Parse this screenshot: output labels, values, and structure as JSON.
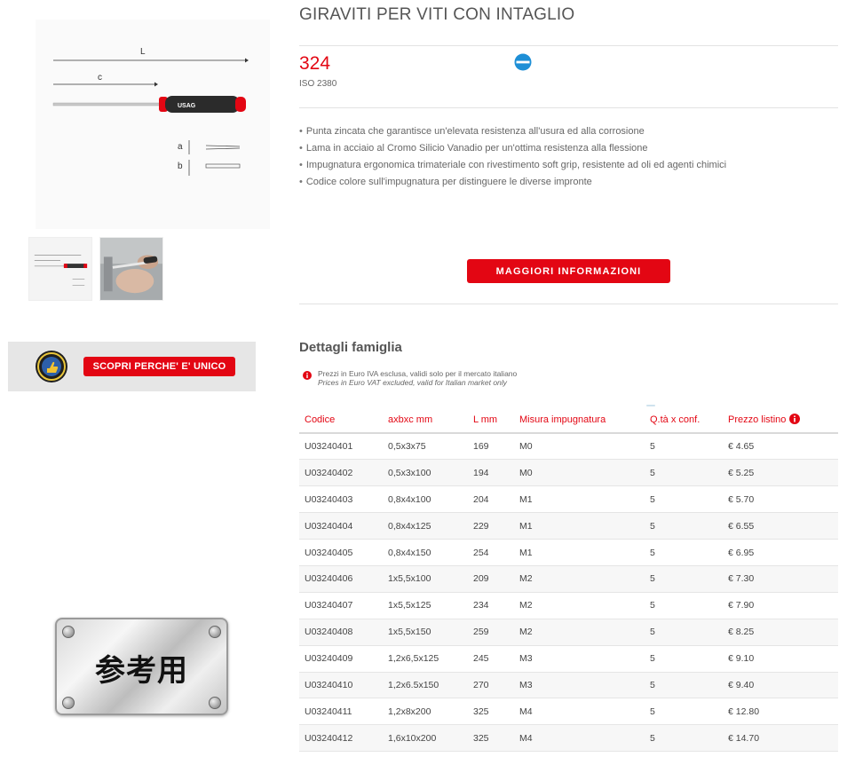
{
  "product": {
    "title": "GIRAVITI PER VITI CON INTAGLIO",
    "code": "324",
    "standard": "ISO 2380",
    "features": [
      "Punta zincata che garantisce un'elevata resistenza all'usura ed alla corrosione",
      "Lama in acciaio al Cromo Silicio Vanadio per un'ottima resistenza alla flessione",
      "Impugnatura ergonomica trimateriale con rivestimento soft grip, resistente ad oli ed agenti chimici",
      "Codice colore sull'impugnatura per distinguere le diverse impronte"
    ],
    "more_info_label": "MAGGIORI INFORMAZIONI",
    "slot_icon": "slot-tip-icon",
    "accent_color": "#e30613",
    "icon_color": "#1e8fd6"
  },
  "drawing": {
    "label_L": "L",
    "label_c": "c",
    "label_a": "a",
    "label_b": "b",
    "handle_brand": "USAG"
  },
  "promo": {
    "button_label": "SCOPRI PERCHE' E' UNICO",
    "seal_icon": "quality-seal-icon"
  },
  "watermark": {
    "text": "参考用"
  },
  "family": {
    "title": "Dettagli famiglia",
    "note_it": "Prezzi in Euro IVA esclusa, validi solo per il mercato italiano",
    "note_en": "Prices in Euro VAT excluded, valid for Italian market only"
  },
  "table": {
    "headers": {
      "code": "Codice",
      "size": "axbxc mm",
      "length": "L mm",
      "grip": "Misura impugnatura",
      "qty": "Q.tà x conf.",
      "price": "Prezzo listino"
    },
    "rows": [
      {
        "code": "U03240401",
        "size": "0,5x3x75",
        "length": "169",
        "grip": "M0",
        "qty": "5",
        "price": "€ 4.65"
      },
      {
        "code": "U03240402",
        "size": "0,5x3x100",
        "length": "194",
        "grip": "M0",
        "qty": "5",
        "price": "€ 5.25"
      },
      {
        "code": "U03240403",
        "size": "0,8x4x100",
        "length": "204",
        "grip": "M1",
        "qty": "5",
        "price": "€ 5.70"
      },
      {
        "code": "U03240404",
        "size": "0,8x4x125",
        "length": "229",
        "grip": "M1",
        "qty": "5",
        "price": "€ 6.55"
      },
      {
        "code": "U03240405",
        "size": "0,8x4x150",
        "length": "254",
        "grip": "M1",
        "qty": "5",
        "price": "€ 6.95"
      },
      {
        "code": "U03240406",
        "size": "1x5,5x100",
        "length": "209",
        "grip": "M2",
        "qty": "5",
        "price": "€ 7.30"
      },
      {
        "code": "U03240407",
        "size": "1x5,5x125",
        "length": "234",
        "grip": "M2",
        "qty": "5",
        "price": "€ 7.90"
      },
      {
        "code": "U03240408",
        "size": "1x5,5x150",
        "length": "259",
        "grip": "M2",
        "qty": "5",
        "price": "€ 8.25"
      },
      {
        "code": "U03240409",
        "size": "1,2x6,5x125",
        "length": "245",
        "grip": "M3",
        "qty": "5",
        "price": "€ 9.10"
      },
      {
        "code": "U03240410",
        "size": "1,2x6.5x150",
        "length": "270",
        "grip": "M3",
        "qty": "5",
        "price": "€ 9.40"
      },
      {
        "code": "U03240411",
        "size": "1,2x8x200",
        "length": "325",
        "grip": "M4",
        "qty": "5",
        "price": "€ 12.80"
      },
      {
        "code": "U03240412",
        "size": "1,6x10x200",
        "length": "325",
        "grip": "M4",
        "qty": "5",
        "price": "€ 14.70"
      }
    ]
  }
}
